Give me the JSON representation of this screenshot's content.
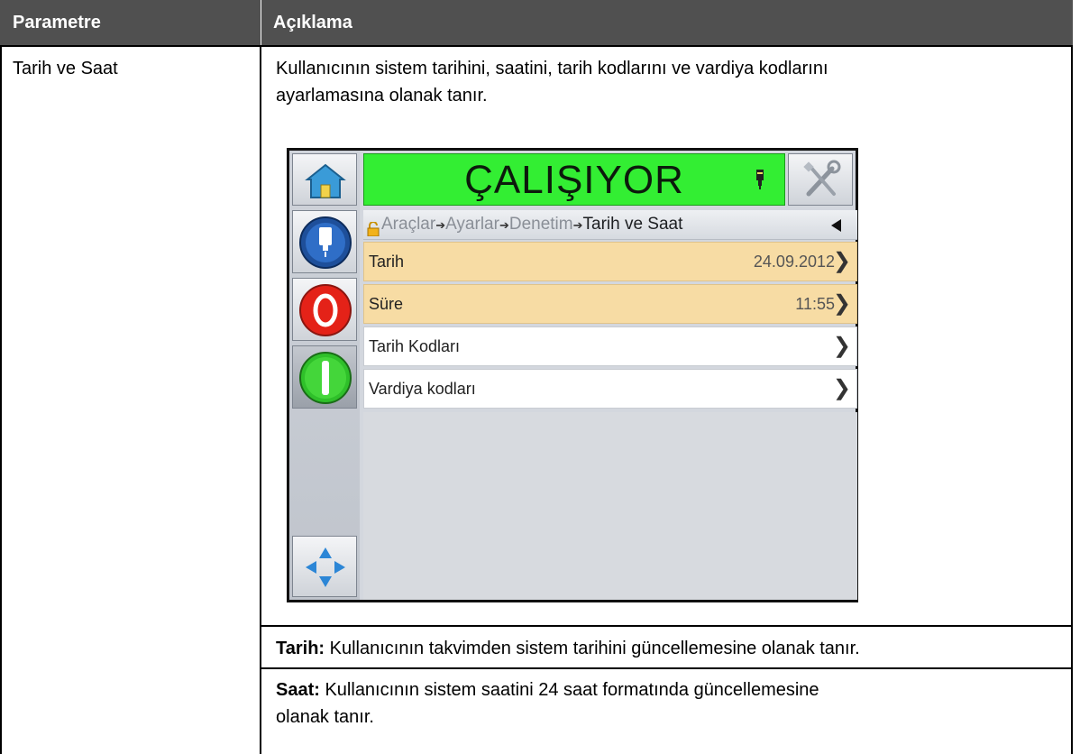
{
  "table": {
    "header_param": "Parametre",
    "header_desc": "Açıklama",
    "param_name": "Tarih ve Saat",
    "intro_line1": "Kullanıcının sistem tarihini, saatini, tarih kodlarını ve vardiya kodlarını",
    "intro_line2": "ayarlamasına olanak tanır.",
    "row2_bold": "Tarih:",
    "row2_text": " Kullanıcının takvimden sistem tarihini güncellemesine olanak tanır.",
    "row3_bold": "Saat:",
    "row3_text_line1": " Kullanıcının sistem saatini 24 saat formatında güncellemesine",
    "row3_text_line2": "olanak tanır."
  },
  "device": {
    "status": "ÇALIŞIYOR",
    "status_color": "#33ee33",
    "breadcrumb": {
      "lock_icon": "lock-open-icon",
      "items": [
        "Araçlar",
        "Ayarlar",
        "Denetim"
      ],
      "current": "Tarih ve Saat",
      "separator": "➔"
    },
    "menu": [
      {
        "label": "Tarih",
        "value": "24.09.2012",
        "highlighted": true
      },
      {
        "label": "Süre",
        "value": "11:55",
        "highlighted": true
      },
      {
        "label": "Tarih Kodları",
        "value": "",
        "highlighted": false
      },
      {
        "label": "Vardiya kodları",
        "value": "",
        "highlighted": false
      }
    ],
    "icons": [
      "home-icon",
      "ink-cartridge-icon",
      "tools-icon",
      "printhead-icon",
      "stop-icon",
      "start-icon",
      "navigation-arrows-icon",
      "back-arrow-icon",
      "chevron-right-icon"
    ]
  }
}
